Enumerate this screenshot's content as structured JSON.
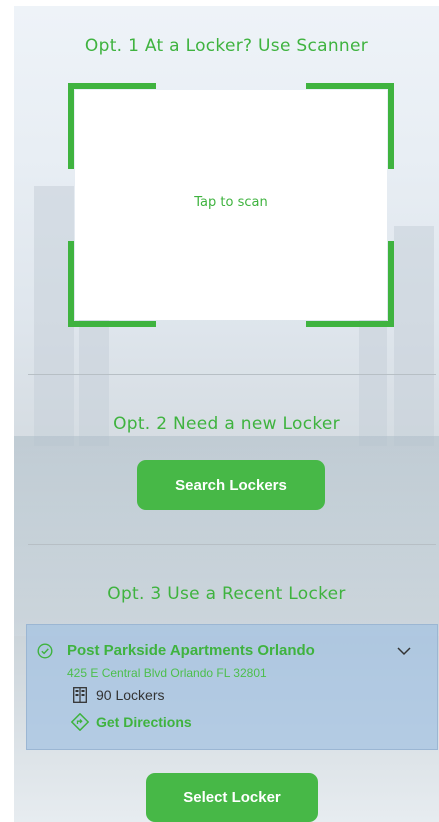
{
  "option1": {
    "title": "Opt. 1 At a Locker? Use Scanner",
    "scan_label": "Tap to scan"
  },
  "option2": {
    "title": "Opt. 2 Need a new Locker",
    "button_label": "Search Lockers"
  },
  "option3": {
    "title": "Opt. 3 Use a Recent Locker",
    "locker": {
      "name": "Post Parkside Apartments Orlando",
      "address": "425 E Central Blvd Orlando FL 32801",
      "count": "90 Lockers",
      "directions": "Get Directions"
    },
    "button_label": "Select Locker"
  },
  "icons": {
    "check": "check-circle-icon",
    "locker": "locker-icon",
    "directions": "directions-icon",
    "expand": "chevron-down-icon"
  },
  "colors": {
    "accent": "#3fb33f",
    "button": "#47b847",
    "card": "#a3c2e2"
  }
}
